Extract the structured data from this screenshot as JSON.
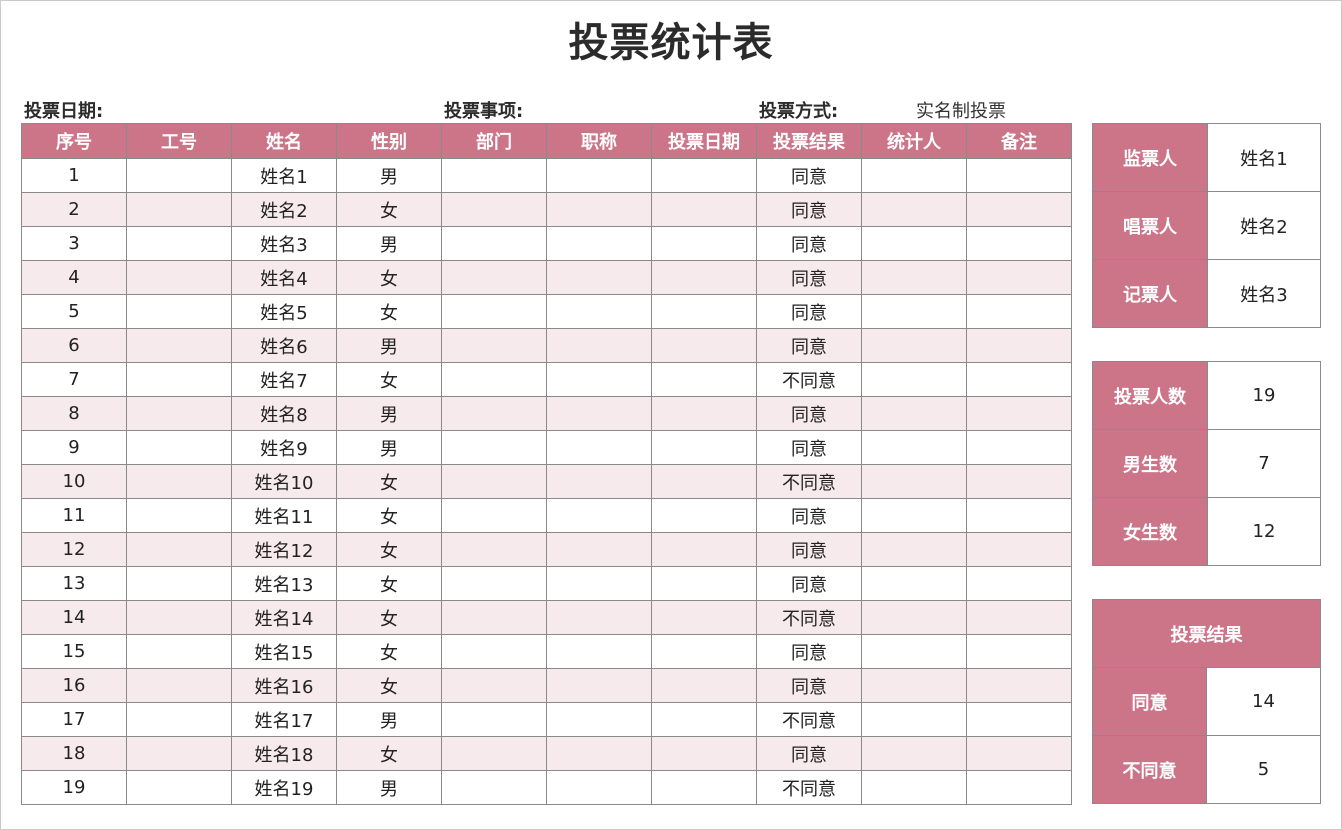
{
  "title": "投票统计表",
  "meta": {
    "date_label": "投票日期:",
    "item_label": "投票事项:",
    "method_label": "投票方式:",
    "method_value": "实名制投票"
  },
  "table": {
    "headers": [
      "序号",
      "工号",
      "姓名",
      "性别",
      "部门",
      "职称",
      "投票日期",
      "投票结果",
      "统计人",
      "备注"
    ],
    "rows": [
      [
        "1",
        "",
        "姓名1",
        "男",
        "",
        "",
        "",
        "同意",
        "",
        ""
      ],
      [
        "2",
        "",
        "姓名2",
        "女",
        "",
        "",
        "",
        "同意",
        "",
        ""
      ],
      [
        "3",
        "",
        "姓名3",
        "男",
        "",
        "",
        "",
        "同意",
        "",
        ""
      ],
      [
        "4",
        "",
        "姓名4",
        "女",
        "",
        "",
        "",
        "同意",
        "",
        ""
      ],
      [
        "5",
        "",
        "姓名5",
        "女",
        "",
        "",
        "",
        "同意",
        "",
        ""
      ],
      [
        "6",
        "",
        "姓名6",
        "男",
        "",
        "",
        "",
        "同意",
        "",
        ""
      ],
      [
        "7",
        "",
        "姓名7",
        "女",
        "",
        "",
        "",
        "不同意",
        "",
        ""
      ],
      [
        "8",
        "",
        "姓名8",
        "男",
        "",
        "",
        "",
        "同意",
        "",
        ""
      ],
      [
        "9",
        "",
        "姓名9",
        "男",
        "",
        "",
        "",
        "同意",
        "",
        ""
      ],
      [
        "10",
        "",
        "姓名10",
        "女",
        "",
        "",
        "",
        "不同意",
        "",
        ""
      ],
      [
        "11",
        "",
        "姓名11",
        "女",
        "",
        "",
        "",
        "同意",
        "",
        ""
      ],
      [
        "12",
        "",
        "姓名12",
        "女",
        "",
        "",
        "",
        "同意",
        "",
        ""
      ],
      [
        "13",
        "",
        "姓名13",
        "女",
        "",
        "",
        "",
        "同意",
        "",
        ""
      ],
      [
        "14",
        "",
        "姓名14",
        "女",
        "",
        "",
        "",
        "不同意",
        "",
        ""
      ],
      [
        "15",
        "",
        "姓名15",
        "女",
        "",
        "",
        "",
        "同意",
        "",
        ""
      ],
      [
        "16",
        "",
        "姓名16",
        "女",
        "",
        "",
        "",
        "同意",
        "",
        ""
      ],
      [
        "17",
        "",
        "姓名17",
        "男",
        "",
        "",
        "",
        "不同意",
        "",
        ""
      ],
      [
        "18",
        "",
        "姓名18",
        "女",
        "",
        "",
        "",
        "同意",
        "",
        ""
      ],
      [
        "19",
        "",
        "姓名19",
        "男",
        "",
        "",
        "",
        "不同意",
        "",
        ""
      ]
    ]
  },
  "staff": {
    "supervisor_label": "监票人",
    "supervisor": "姓名1",
    "caller_label": "唱票人",
    "caller": "姓名2",
    "recorder_label": "记票人",
    "recorder": "姓名3"
  },
  "counts": {
    "voters_label": "投票人数",
    "voters": "19",
    "male_label": "男生数",
    "male": "7",
    "female_label": "女生数",
    "female": "12"
  },
  "result": {
    "header": "投票结果",
    "agree_label": "同意",
    "agree": "14",
    "disagree_label": "不同意",
    "disagree": "5"
  },
  "colors": {
    "accent": "#cc7589",
    "row_alt": "#f7eaed",
    "border": "#8a8a8a"
  }
}
